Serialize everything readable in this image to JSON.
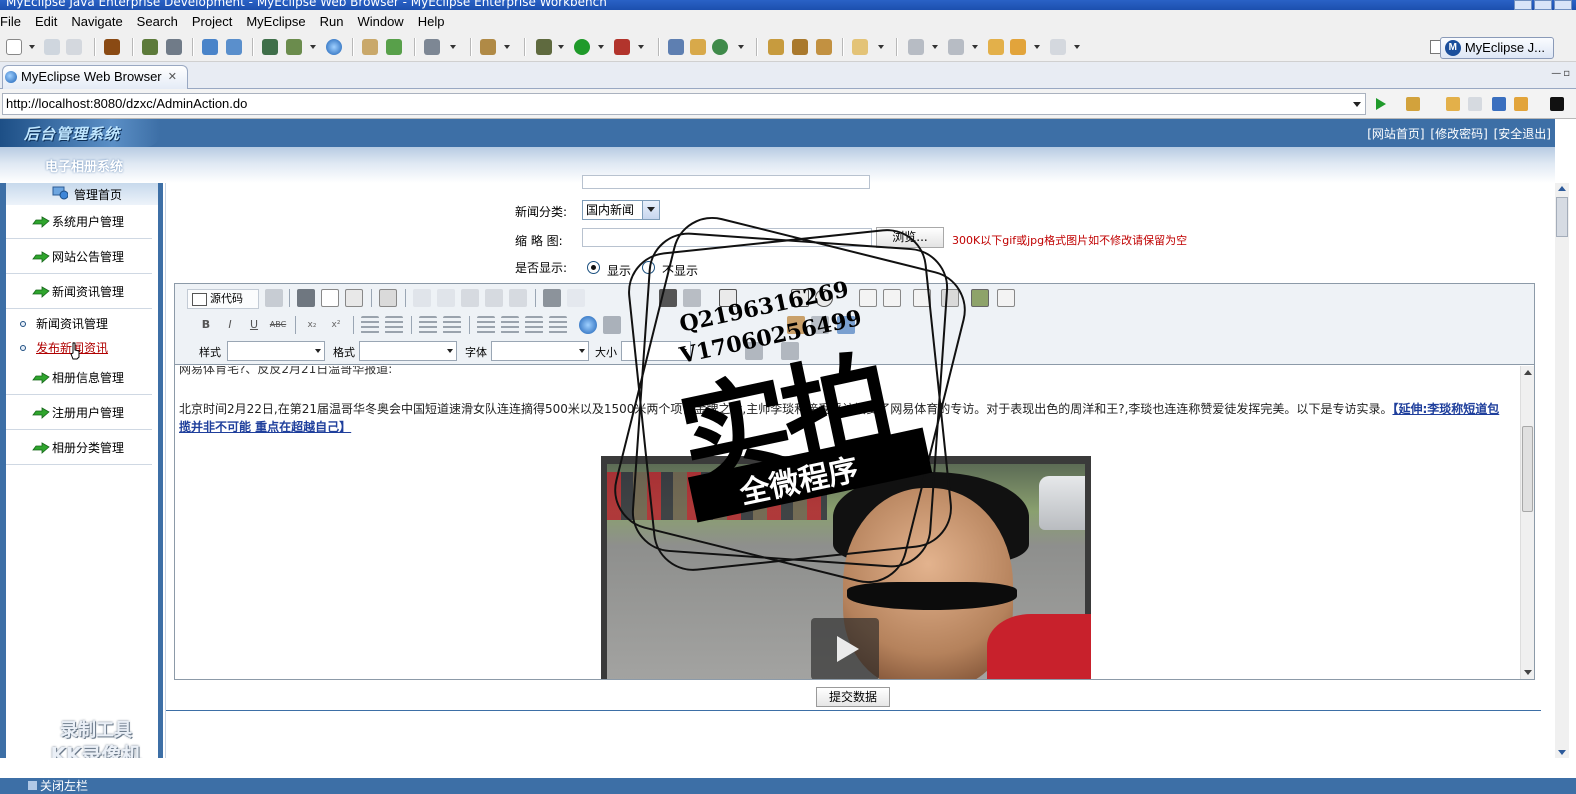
{
  "window": {
    "title": "MyEclipse Java Enterprise Development - MyEclipse Web Browser - MyEclipse Enterprise Workbench"
  },
  "menu": [
    "File",
    "Edit",
    "Navigate",
    "Search",
    "Project",
    "MyEclipse",
    "Run",
    "Window",
    "Help"
  ],
  "perspective": {
    "label": "MyEclipse J..."
  },
  "editor_tab": {
    "label": "MyEclipse Web Browser"
  },
  "browser": {
    "url": "http://localhost:8080/dzxc/AdminAction.do"
  },
  "app": {
    "logo": "后台管理系统",
    "top_links": [
      "[网站首页]",
      "[修改密码]",
      "[安全退出]"
    ],
    "system_title": "电子相册系统",
    "nav_home": "管理首页",
    "nav": [
      {
        "label": "系统用户管理"
      },
      {
        "label": "网站公告管理"
      },
      {
        "label": "新闻资讯管理"
      }
    ],
    "nav_sub": [
      {
        "label": "新闻资讯管理"
      },
      {
        "label": "发布新闻资讯"
      }
    ],
    "nav_after": [
      {
        "label": "相册信息管理"
      },
      {
        "label": "注册用户管理"
      },
      {
        "label": "相册分类管理"
      }
    ],
    "recorder_watermark": [
      "录制工具",
      "KK录像机"
    ],
    "form": {
      "category_label": "新闻分类:",
      "category_value": "国内新闻",
      "thumb_label": "缩 略 图:",
      "browse_label": "浏览...",
      "thumb_hint": "300K以下gif或jpg格式图片如不修改请保留为空",
      "show_label": "是否显示:",
      "show_yes": "显示",
      "show_no": "不显示",
      "show_selected": "显示"
    },
    "editor": {
      "source_button": "源代码",
      "style_label": "样式",
      "format_label": "格式",
      "font_label": "字体",
      "size_label": "大小",
      "line0": "网易体育宅?、反反2月21日温哥华报道:",
      "para_text": "北京时间2月22日,在第21届温哥华冬奥会中国短道速滑女队连连摘得500米以及1500米两个项目金牌之后,主帅李琰和接受采访接受了网易体育的专访。对于表现出色的周洋和王?,李琰也连连称赞爱徒发挥完美。以下是专访实录。",
      "para_link": "【延伸:李琰称短道包揽并非不可能 重点在超越自己】"
    },
    "submit_label": "提交数据",
    "footer": "关闭左栏"
  },
  "stamp": {
    "main": "实拍",
    "band": "全微程序",
    "q": "Q2196316269",
    "v": "V17060256499"
  }
}
